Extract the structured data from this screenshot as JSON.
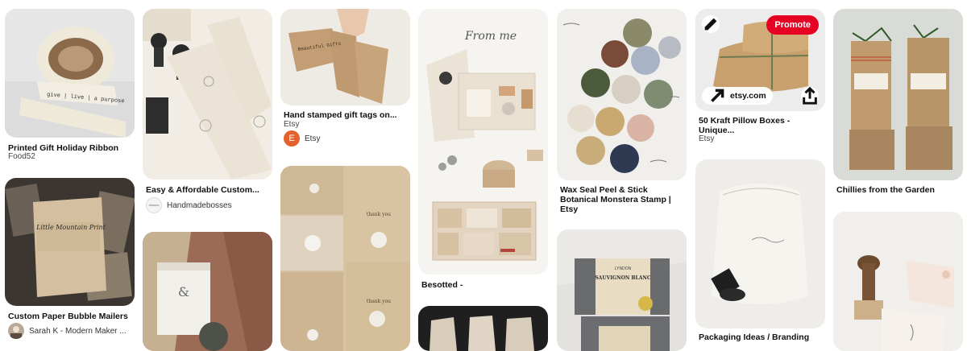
{
  "pins": [
    {
      "id": "ribbon",
      "title": "Printed Gift Holiday Ribbon",
      "source": "Food52"
    },
    {
      "id": "mailers",
      "title": "Custom Paper Bubble Mailers",
      "user": "Sarah K - Modern Maker ..."
    },
    {
      "id": "stamps",
      "title": "Easy & Affordable Custom...",
      "user": "Handmadebosses"
    },
    {
      "id": "tags",
      "title": "Hand stamped gift tags on...",
      "source": "Etsy",
      "user": "Etsy",
      "user_initial": "E"
    },
    {
      "id": "besotted",
      "title": "Besotted -"
    },
    {
      "id": "wax",
      "title": "Wax Seal Peel & Stick Botanical Monstera Stamp | Etsy"
    },
    {
      "id": "pillow",
      "title": "50 Kraft Pillow Boxes - Unique...",
      "source": "Etsy",
      "promote_label": "Promote",
      "link_label": "etsy.com"
    },
    {
      "id": "packaging",
      "title": "Packaging Ideas / Branding"
    },
    {
      "id": "chillies",
      "title": "Chillies from the Garden"
    }
  ],
  "image_text": {
    "ribbon": "give | live | a purpose",
    "tag_card": "Beautiful Gifts",
    "thank_you": "thank you",
    "from_me": "From me",
    "mailer_logo": "Little Mountain Print",
    "soap_name": "SAUVIGNON BLANC",
    "soap_brand": "LYNDON"
  },
  "colors": {
    "promote": "#e60023",
    "etsy_avatar": "#e2612c",
    "kraft": "#c9a97c",
    "cream": "#ece6da"
  },
  "icons": [
    "edit-icon",
    "arrow-up-right-icon",
    "share-icon"
  ]
}
